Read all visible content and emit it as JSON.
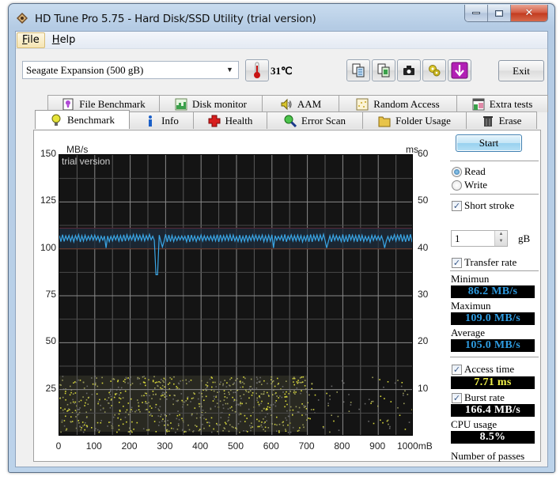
{
  "window": {
    "title": "HD Tune Pro 5.75 - Hard Disk/SSD Utility (trial version)",
    "controls": {
      "minimize": "minimize",
      "maximize": "maximize",
      "close": "✕"
    }
  },
  "menu": {
    "items": [
      {
        "label": "File",
        "mnemonic": "F",
        "rest": "ile"
      },
      {
        "label": "Help",
        "mnemonic": "H",
        "rest": "elp"
      }
    ]
  },
  "toolbar": {
    "drive": "Seagate Expansion (500 gB)",
    "dropdown_arrow": "▼",
    "temperature": "31℃",
    "exit_label": "Exit",
    "icons": [
      "copy-text-icon",
      "copy-screenshot-icon",
      "camera-icon",
      "options-icon",
      "save-icon"
    ]
  },
  "tabs": {
    "back_row": [
      {
        "label": "File Benchmark",
        "icon": "file-benchmark-icon"
      },
      {
        "label": "Disk monitor",
        "icon": "disk-monitor-icon"
      },
      {
        "label": "AAM",
        "icon": "speaker-icon"
      },
      {
        "label": "Random Access",
        "icon": "random-access-icon"
      },
      {
        "label": "Extra tests",
        "icon": "extra-tests-icon"
      }
    ],
    "front_row": [
      {
        "label": "Benchmark",
        "icon": "lightbulb-icon",
        "selected": true
      },
      {
        "label": "Info",
        "icon": "info-icon"
      },
      {
        "label": "Health",
        "icon": "health-cross-icon"
      },
      {
        "label": "Error Scan",
        "icon": "magnifier-icon"
      },
      {
        "label": "Folder Usage",
        "icon": "folder-icon"
      },
      {
        "label": "Erase",
        "icon": "trash-icon"
      }
    ]
  },
  "side": {
    "start_label": "Start",
    "read_label": "Read",
    "write_label": "Write",
    "mode": "read",
    "short_stroke_label": "Short stroke",
    "short_stroke_checked": true,
    "short_stroke_value": "1",
    "short_stroke_unit": "gB",
    "transfer_rate_label": "Transfer rate",
    "transfer_rate_checked": true,
    "minimum_label": "Minimun",
    "minimum_value": "86.2 MB/s",
    "maximum_label": "Maximun",
    "maximum_value": "109.0 MB/s",
    "average_label": "Average",
    "average_value": "105.0 MB/s",
    "access_time_label": "Access time",
    "access_time_checked": true,
    "access_time_value": "7.71 ms",
    "burst_rate_label": "Burst rate",
    "burst_rate_checked": true,
    "burst_rate_value": "166.4 MB/s",
    "cpu_usage_label": "CPU usage",
    "cpu_usage_value": "8.5%",
    "passes_label": "Number of passes"
  },
  "chart_data": {
    "type": "line",
    "watermark": "trial version",
    "left_axis_label": "MB/s",
    "right_axis_label": "ms",
    "x_unit_label": "1000mB",
    "x_ticks": [
      "0",
      "100",
      "200",
      "300",
      "400",
      "500",
      "600",
      "700",
      "800",
      "900",
      "1000mB"
    ],
    "y_left_ticks": [
      "150",
      "125",
      "100",
      "75",
      "50",
      "25"
    ],
    "y_right_ticks": [
      "60",
      "50",
      "40",
      "30",
      "20",
      "10"
    ],
    "xlim": [
      0,
      1000
    ],
    "ylim_left": [
      0,
      150
    ],
    "ylim_right": [
      0,
      60
    ],
    "grid": true,
    "series": [
      {
        "name": "Transfer rate (MB/s)",
        "color": "#3aa6e6",
        "baseline": 105.0,
        "min": 86.2,
        "max": 109.0,
        "dips": [
          {
            "x": 130,
            "y": 100.5
          },
          {
            "x": 275,
            "y": 86.2
          },
          {
            "x": 290,
            "y": 101.0
          },
          {
            "x": 605,
            "y": 100.5
          },
          {
            "x": 755,
            "y": 100.5
          },
          {
            "x": 920,
            "y": 100.5
          }
        ]
      },
      {
        "name": "Access time (ms)",
        "type": "scatter",
        "color": "#d8d83a",
        "mean": 7.71,
        "range": [
          1,
          13
        ]
      }
    ]
  }
}
